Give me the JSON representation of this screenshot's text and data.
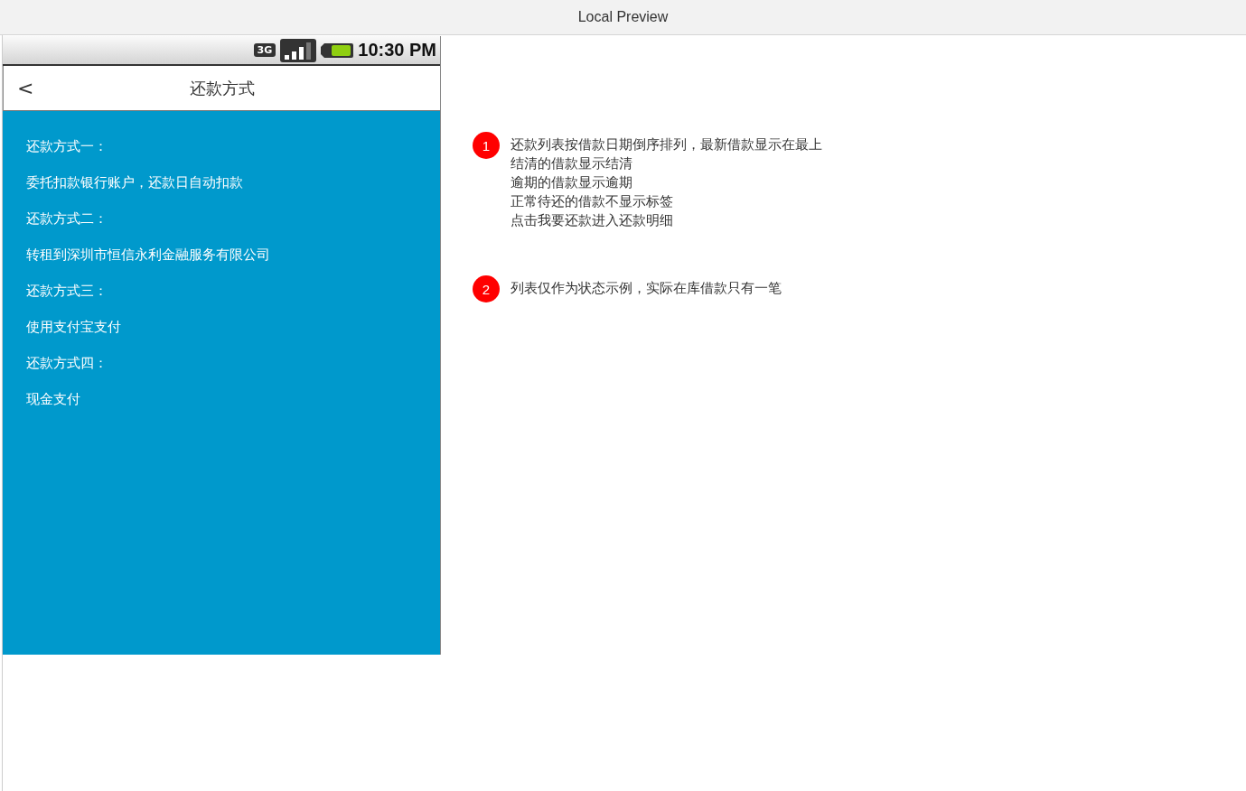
{
  "window": {
    "title": "Local Preview"
  },
  "status_bar": {
    "network": "3G",
    "time": "10:30 PM"
  },
  "header": {
    "back": "<",
    "title": "还款方式"
  },
  "methods": [
    {
      "label": "还款方式一：",
      "detail": "委托扣款银行账户，还款日自动扣款"
    },
    {
      "label": "还款方式二：",
      "detail": "转租到深圳市恒信永利金融服务有限公司"
    },
    {
      "label": "还款方式三：",
      "detail": "使用支付宝支付"
    },
    {
      "label": "还款方式四：",
      "detail": "现金支付"
    }
  ],
  "notes": [
    {
      "number": "1",
      "lines": [
        "还款列表按借款日期倒序排列，最新借款显示在最上",
        "结清的借款显示结清",
        "逾期的借款显示逾期",
        "正常待还的借款不显示标签",
        "点击我要还款进入还款明细"
      ]
    },
    {
      "number": "2",
      "lines": [
        "列表仅作为状态示例，实际在库借款只有一笔"
      ]
    }
  ]
}
